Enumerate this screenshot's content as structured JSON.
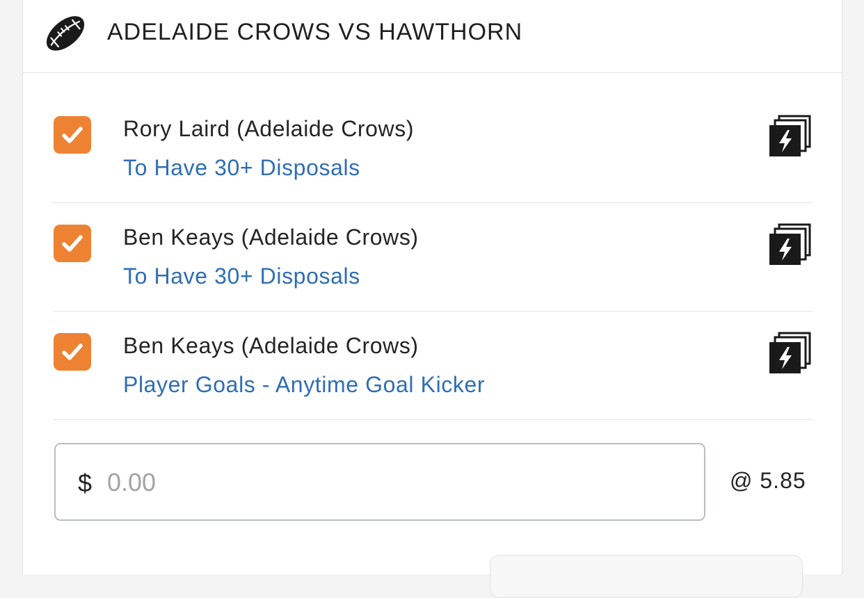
{
  "event": {
    "title": "ADELAIDE CROWS VS HAWTHORN",
    "sport_icon": "football-icon"
  },
  "selections": [
    {
      "checked": true,
      "name": "Rory Laird (Adelaide Crows)",
      "market": "To Have 30+ Disposals",
      "icon": "same-game-multi-bolt-icon"
    },
    {
      "checked": true,
      "name": "Ben Keays (Adelaide Crows)",
      "market": "To Have 30+ Disposals",
      "icon": "same-game-multi-bolt-icon"
    },
    {
      "checked": true,
      "name": "Ben Keays (Adelaide Crows)",
      "market": "Player Goals - Anytime Goal Kicker",
      "icon": "same-game-multi-bolt-icon"
    }
  ],
  "stake": {
    "currency": "$",
    "placeholder": "0.00",
    "value": ""
  },
  "odds_label": "@ 5.85",
  "colors": {
    "checkbox": "#ee8233",
    "market_link": "#2f6eb4",
    "text": "#242424"
  }
}
